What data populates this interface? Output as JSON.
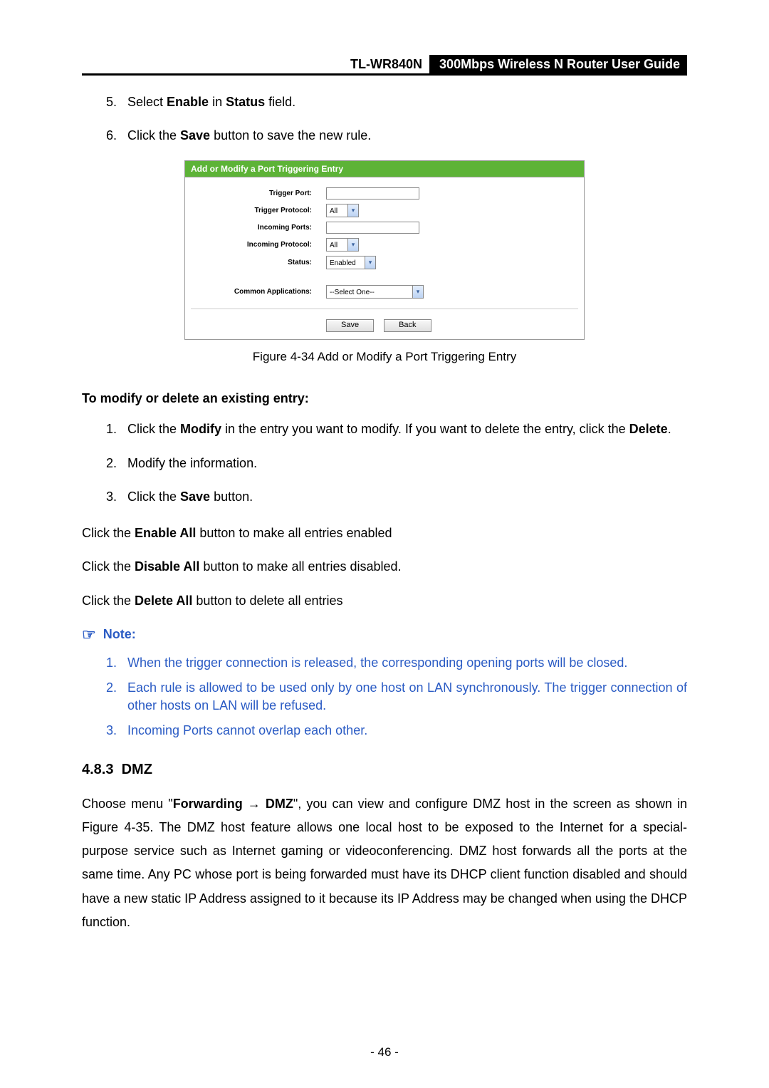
{
  "header": {
    "model": "TL-WR840N",
    "title": "300Mbps Wireless N Router User Guide"
  },
  "steps_top": [
    {
      "num": "5.",
      "pre": "Select ",
      "b1": "Enable",
      "mid": " in ",
      "b2": "Status",
      "post": " field."
    },
    {
      "num": "6.",
      "pre": "Click the ",
      "b1": "Save",
      "mid": " button to save the new rule.",
      "b2": "",
      "post": ""
    }
  ],
  "screenshot": {
    "title": "Add or Modify a Port Triggering Entry",
    "rows": {
      "trigger_port": {
        "lbl": "Trigger Port:",
        "val": ""
      },
      "trigger_protocol": {
        "lbl": "Trigger Protocol:",
        "val": "All"
      },
      "incoming_ports": {
        "lbl": "Incoming Ports:",
        "val": ""
      },
      "incoming_protocol": {
        "lbl": "Incoming Protocol:",
        "val": "All"
      },
      "status": {
        "lbl": "Status:",
        "val": "Enabled"
      },
      "common_apps": {
        "lbl": "Common Applications:",
        "val": "--Select One--"
      }
    },
    "buttons": {
      "save": "Save",
      "back": "Back"
    }
  },
  "caption": "Figure 4-34    Add or Modify a Port Triggering Entry",
  "modify_head": "To modify or delete an existing entry:",
  "modify_steps": [
    {
      "num": "1.",
      "pre": "Click the ",
      "b1": "Modify",
      "mid": " in the entry you want to modify. If you want to delete the entry, click the ",
      "b2": "Delete",
      "post": "."
    },
    {
      "num": "2.",
      "pre": "Modify the information.",
      "b1": "",
      "mid": "",
      "b2": "",
      "post": ""
    },
    {
      "num": "3.",
      "pre": "Click the ",
      "b1": "Save",
      "mid": " button.",
      "b2": "",
      "post": ""
    }
  ],
  "bulk_lines": [
    {
      "pre": "Click the ",
      "b": "Enable All",
      "post": " button to make all entries enabled"
    },
    {
      "pre": "Click the ",
      "b": "Disable All",
      "post": " button to make all entries disabled."
    },
    {
      "pre": "Click the ",
      "b": "Delete All",
      "post": " button to delete all entries"
    }
  ],
  "note_label": "Note:",
  "note_items": [
    {
      "num": "1.",
      "txt": "When the trigger connection is released, the corresponding opening ports will be closed."
    },
    {
      "num": "2.",
      "txt": "Each rule is allowed to be used only by one host on LAN synchronously. The trigger connection of other hosts on LAN will be refused."
    },
    {
      "num": "3.",
      "txt": "Incoming Ports cannot overlap each other."
    }
  ],
  "section": {
    "num": "4.8.3",
    "title": "DMZ"
  },
  "dmz_para": {
    "p1": "Choose menu \"",
    "b1": "Forwarding",
    "arrow": " → ",
    "b2": "DMZ",
    "p2": "\", you can view and configure DMZ host in the screen as shown in Figure 4-35. The DMZ host feature allows one local host to be exposed to the Internet for a special-purpose service such as Internet gaming or videoconferencing. DMZ host forwards all the ports at the same time. Any PC whose port is being forwarded must have its DHCP client function disabled and should have a new static IP Address assigned to it because its IP Address may be changed when using the DHCP function."
  },
  "page_number": "- 46 -"
}
